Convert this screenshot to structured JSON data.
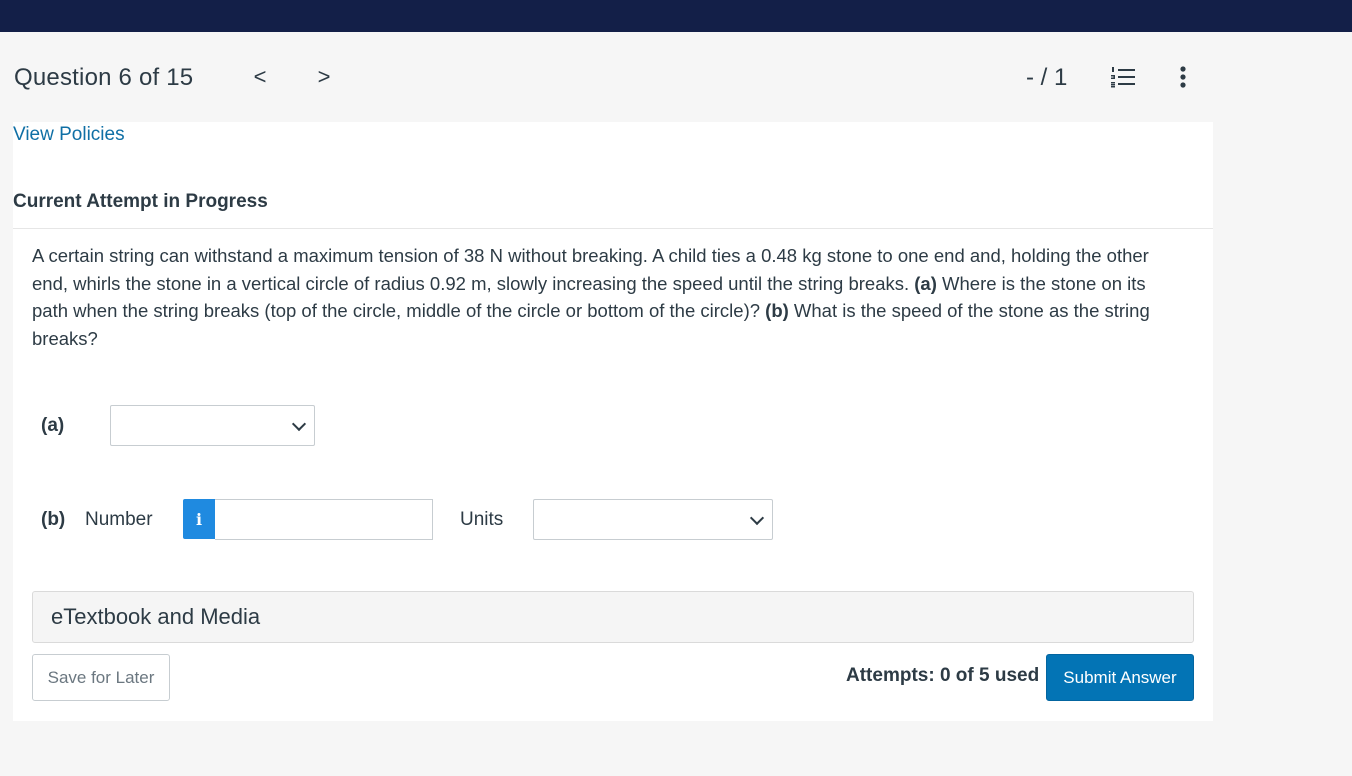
{
  "header": {
    "question_title": "Question 6 of 15",
    "prev_glyph": "<",
    "next_glyph": ">",
    "score": "- / 1",
    "icons": [
      "question-list-icon",
      "more-options-icon"
    ]
  },
  "policies_link": "View Policies",
  "attempt_heading": "Current Attempt in Progress",
  "question": {
    "intro": "A certain string can withstand a maximum tension of 38 N without breaking. A child ties a 0.48 kg stone to one end and, holding the other end, whirls the stone in a vertical circle of radius 0.92 m, slowly increasing the speed until the string breaks. ",
    "part_a_marker": "(a)",
    "part_a_text": " Where is the stone on its path when the string breaks (top of the circle, middle of the circle or bottom of the circle)? ",
    "part_b_marker": "(b)",
    "part_b_text": " What is the speed of the stone as the string breaks?"
  },
  "part_a": {
    "label": "(a)",
    "selected": ""
  },
  "part_b": {
    "label": "(b)",
    "number_label": "Number",
    "info_glyph": "i",
    "number_value": "",
    "units_label": "Units",
    "units_selected": ""
  },
  "etextbook": "eTextbook and Media",
  "footer": {
    "save_label": "Save for Later",
    "attempts": "Attempts: 0 of 5 used",
    "submit_label": "Submit Answer"
  },
  "colors": {
    "topbar": "#131f48",
    "link": "#0f6fa5",
    "primary": "#0374b5",
    "info": "#1f8ae0"
  }
}
